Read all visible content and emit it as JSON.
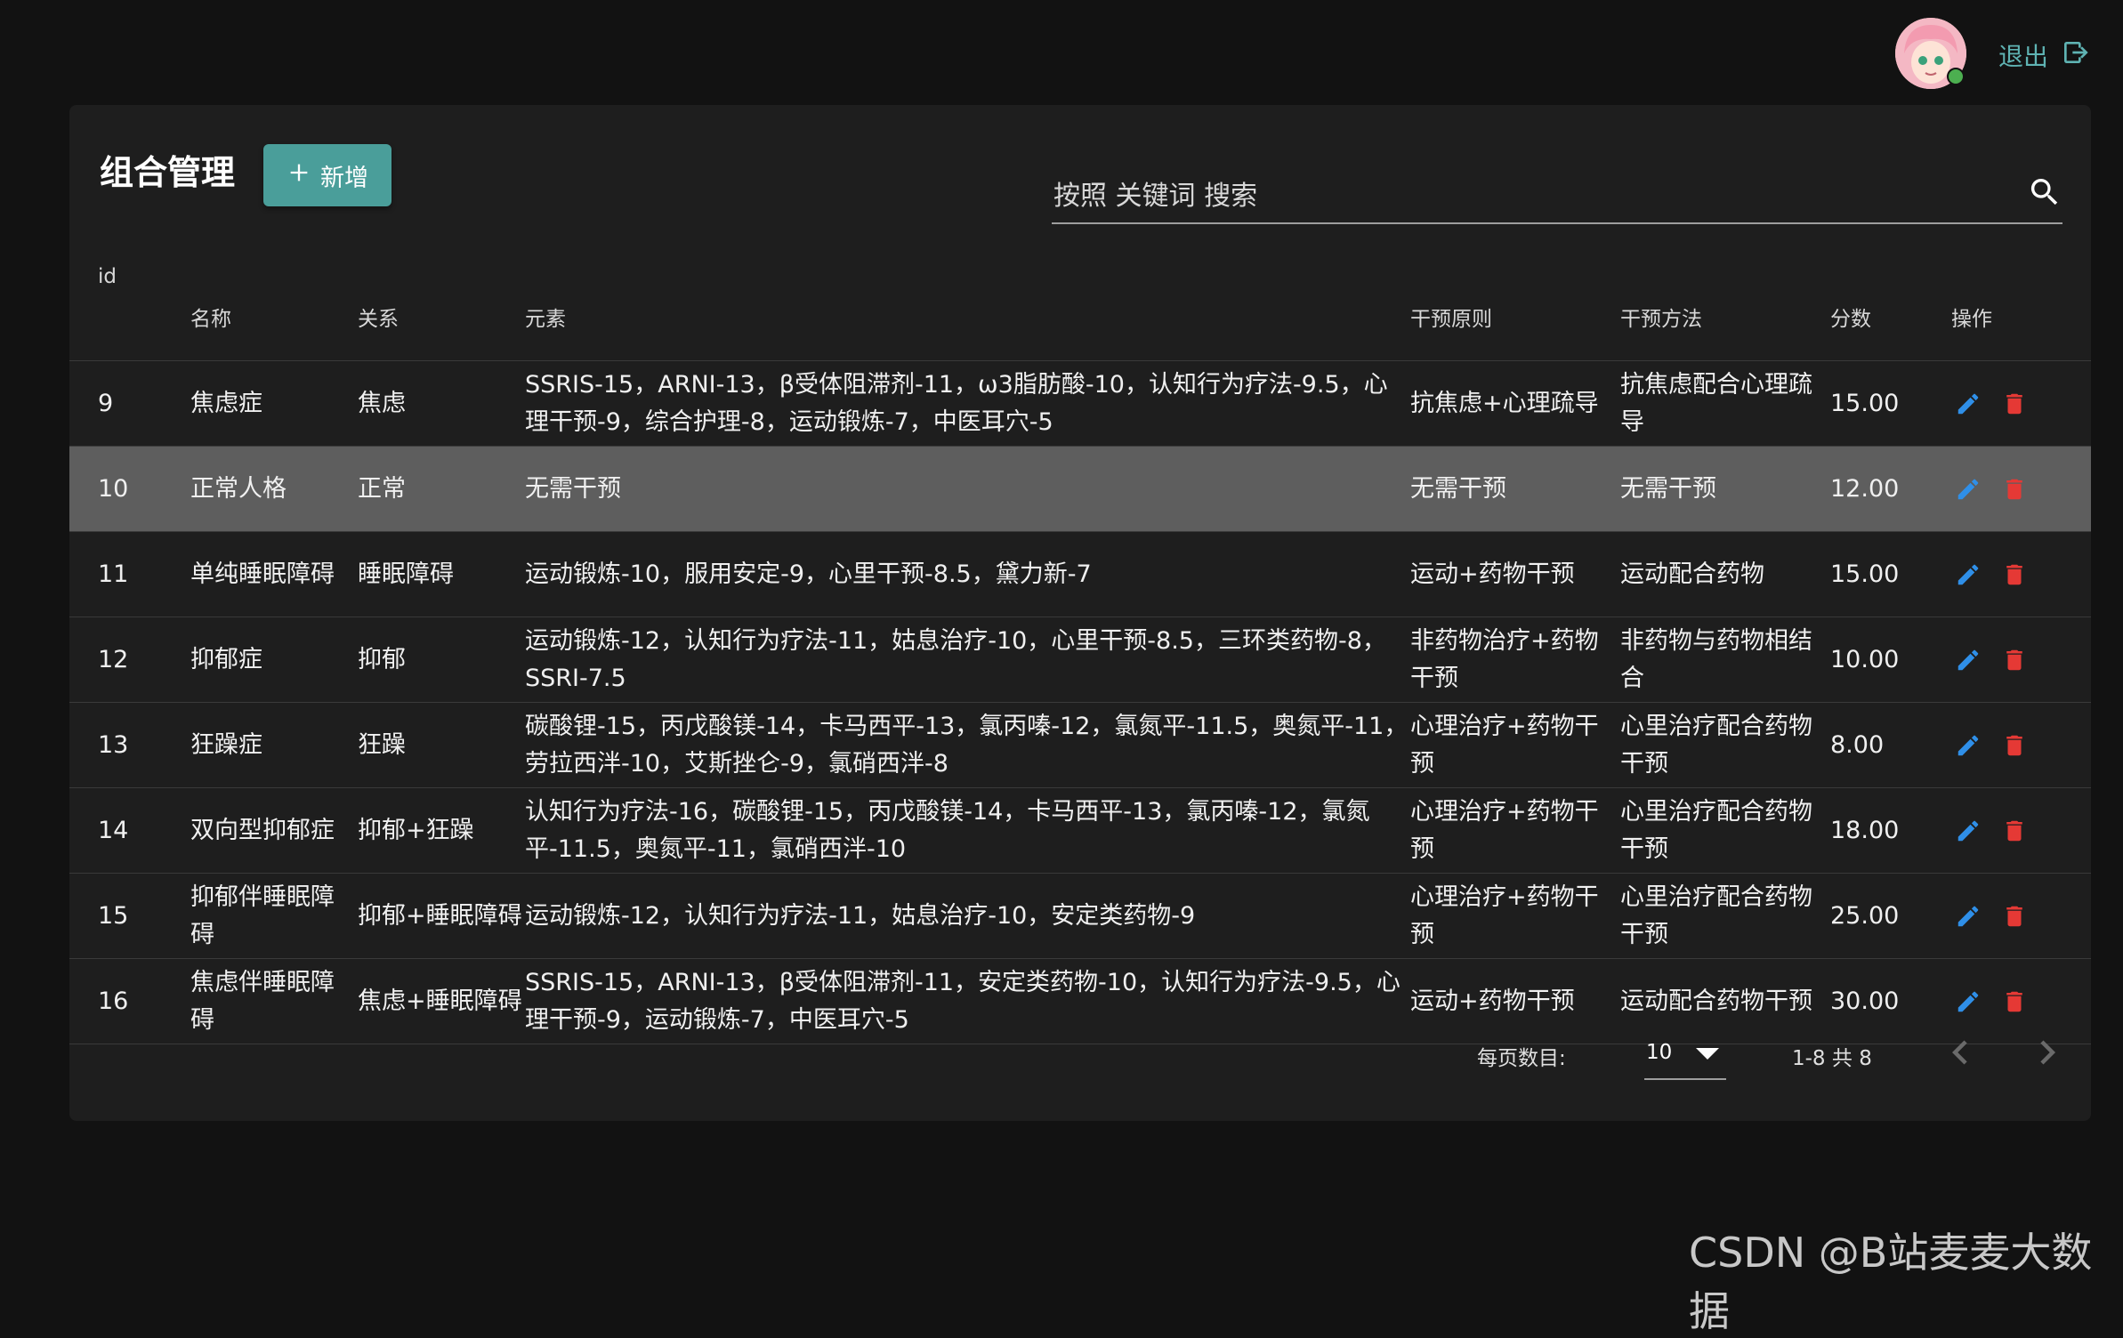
{
  "header": {
    "logout_label": "退出"
  },
  "card": {
    "title": "组合管理",
    "add_label": "新增",
    "search_placeholder": "按照 关键词 搜索"
  },
  "table": {
    "columns": [
      "id",
      "名称",
      "关系",
      "元素",
      "干预原则",
      "干预方法",
      "分数",
      "操作"
    ],
    "rows": [
      {
        "id": "9",
        "name": "焦虑症",
        "relation": "焦虑",
        "elements": "SSRIS-15，ARNI-13，β受体阻滞剂-11，ω3脂肪酸-10，认知行为疗法-9.5，心理干预-9，综合护理-8，运动锻炼-7，中医耳穴-5",
        "principle": "抗焦虑+心理疏导",
        "method": "抗焦虑配合心理疏导",
        "score": "15.00"
      },
      {
        "id": "10",
        "name": "正常人格",
        "relation": "正常",
        "elements": "无需干预",
        "principle": "无需干预",
        "method": "无需干预",
        "score": "12.00"
      },
      {
        "id": "11",
        "name": "单纯睡眠障碍",
        "relation": "睡眠障碍",
        "elements": "运动锻炼-10，服用安定-9，心里干预-8.5，黛力新-7",
        "principle": "运动+药物干预",
        "method": "运动配合药物",
        "score": "15.00"
      },
      {
        "id": "12",
        "name": "抑郁症",
        "relation": "抑郁",
        "elements": "运动锻炼-12，认知行为疗法-11，姑息治疗-10，心里干预-8.5，三环类药物-8，SSRI-7.5",
        "principle": "非药物治疗+药物干预",
        "method": "非药物与药物相结合",
        "score": "10.00"
      },
      {
        "id": "13",
        "name": "狂躁症",
        "relation": "狂躁",
        "elements": "碳酸锂-15，丙戊酸镁-14，卡马西平-13，氯丙嗪-12，氯氮平-11.5，奥氮平-11，劳拉西泮-10，艾斯挫仑-9，氯硝西泮-8",
        "principle": "心理治疗+药物干预",
        "method": "心里治疗配合药物干预",
        "score": "8.00"
      },
      {
        "id": "14",
        "name": "双向型抑郁症",
        "relation": "抑郁+狂躁",
        "elements": "认知行为疗法-16，碳酸锂-15，丙戊酸镁-14，卡马西平-13，氯丙嗪-12，氯氮平-11.5，奥氮平-11，氯硝西泮-10",
        "principle": "心理治疗+药物干预",
        "method": "心里治疗配合药物干预",
        "score": "18.00"
      },
      {
        "id": "15",
        "name": "抑郁伴睡眠障碍",
        "relation": "抑郁+睡眠障碍",
        "elements": "运动锻炼-12，认知行为疗法-11，姑息治疗-10，安定类药物-9",
        "principle": "心理治疗+药物干预",
        "method": "心里治疗配合药物干预",
        "score": "25.00"
      },
      {
        "id": "16",
        "name": "焦虑伴睡眠障碍",
        "relation": "焦虑+睡眠障碍",
        "elements": "SSRIS-15，ARNI-13，β受体阻滞剂-11，安定类药物-10，认知行为疗法-9.5，心理干预-9，运动锻炼-7，中医耳穴-5",
        "principle": "运动+药物干预",
        "method": "运动配合药物干预",
        "score": "30.00"
      }
    ]
  },
  "footer": {
    "rows_per_page_label": "每页数目:",
    "rows_per_page_value": "10",
    "range_text": "1-8 共 8"
  },
  "watermark": "CSDN @B站麦麦大数据",
  "colors": {
    "accent": "#4a9e9a",
    "edit": "#2f8fe8",
    "delete": "#e53935",
    "logout": "#5fb3b3",
    "highlight_row": "#5e5e5e"
  },
  "icons": {
    "add": "plus-icon",
    "search": "search-icon",
    "logout": "logout-icon",
    "edit": "pencil-icon",
    "delete": "trash-icon",
    "prev": "chevron-left-icon",
    "next": "chevron-right-icon",
    "rows_select": "caret-down-icon"
  }
}
